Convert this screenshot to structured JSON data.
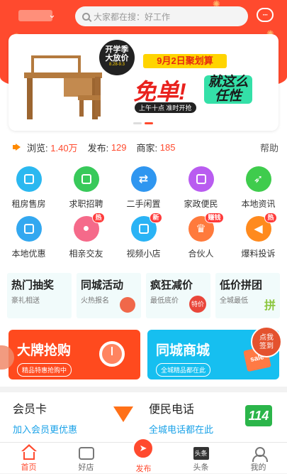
{
  "header": {
    "search_placeholder": "大家都在搜：好工作",
    "message_icon": "chat-bubble-icon",
    "accent_color": "#ff4a2e"
  },
  "banner": {
    "bubble_line1": "开学季",
    "bubble_line2": "大放价",
    "bubble_dates": "8.28-9.3",
    "date_title": "9月2日聚划算",
    "big_text_1": "免单!",
    "big_text_2": "就这么任性",
    "subline": "上午十点 准时开抢"
  },
  "stats": {
    "views_label": "浏览:",
    "views_value": "1.40万",
    "posts_label": "发布:",
    "posts_value": "129",
    "merchants_label": "商家:",
    "merchants_value": "185",
    "help_label": "帮助"
  },
  "grid": {
    "items": [
      {
        "label": "租房售房",
        "icon": "building-icon",
        "color": "#2bb8f0"
      },
      {
        "label": "求职招聘",
        "icon": "document-icon",
        "color": "#38c95a"
      },
      {
        "label": "二手闲置",
        "icon": "exchange-arrows-icon",
        "color": "#2f96f0"
      },
      {
        "label": "家政便民",
        "icon": "inbox-icon",
        "color": "#b95cf0"
      },
      {
        "label": "本地资讯",
        "icon": "rocket-icon",
        "color": "#3fcc4d"
      },
      {
        "label": "本地优惠",
        "icon": "ticket-icon",
        "color": "#33a8f0"
      },
      {
        "label": "相亲交友",
        "icon": "person-icon",
        "color": "#f56a8a",
        "tag": "热"
      },
      {
        "label": "视频小店",
        "icon": "picture-icon",
        "color": "#2ab3f5",
        "tag": "新"
      },
      {
        "label": "合伙人",
        "icon": "crown-icon",
        "color": "#ff7a3c",
        "tag": "赚钱"
      },
      {
        "label": "爆料投诉",
        "icon": "megaphone-icon",
        "color": "#ff8a1e",
        "tag": "热"
      }
    ]
  },
  "promo": [
    {
      "title": "热门抽奖",
      "sub": "豪礼相送"
    },
    {
      "title": "同城活动",
      "sub": "火热报名"
    },
    {
      "title": "疯狂减价",
      "sub": "最低底价"
    },
    {
      "title": "低价拼团",
      "sub": "全城最低"
    }
  ],
  "promo_deco": {
    "tejia": "特价",
    "pin": "拼"
  },
  "big_cards": [
    {
      "title": "大牌抢购",
      "sub": "精品特惠抢购中",
      "color": "#ff4a1e"
    },
    {
      "title": "同城商城",
      "sub": "全城精品都在此",
      "color": "#16bff0"
    }
  ],
  "sale_label": "sale",
  "sign_badge": {
    "line1": "点我",
    "line2": "签到"
  },
  "services": [
    {
      "title": "会员卡",
      "sub": "加入会员更优惠"
    },
    {
      "title": "便民电话",
      "sub": "全城电话都在此"
    }
  ],
  "hotline_number": "114",
  "nav": [
    {
      "label": "首页",
      "active": true
    },
    {
      "label": "好店"
    },
    {
      "label": "发布"
    },
    {
      "label": "头条",
      "icon_text": "头条"
    },
    {
      "label": "我的"
    }
  ]
}
